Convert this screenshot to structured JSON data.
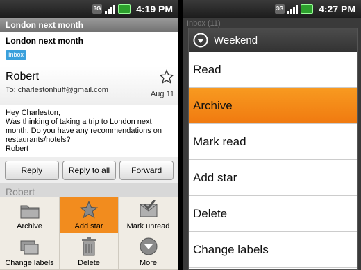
{
  "left": {
    "status_time": "4:19 PM",
    "title": "London next month",
    "subject": "London next month",
    "label": "Inbox",
    "message": {
      "sender": "Robert",
      "to": "To: charlestonhuff@gmail.com",
      "date": "Aug 11",
      "body_lines": [
        "Hey Charleston,",
        "Was thinking of taking a trip to London next",
        "month. Do you have any recommendations on",
        "restaurants/hotels?",
        "Robert"
      ]
    },
    "buttons": {
      "reply": "Reply",
      "reply_all": "Reply to all",
      "forward": "Forward"
    },
    "ghost_sender": "Robert",
    "actions": [
      {
        "label": "Archive",
        "icon": "folder-icon"
      },
      {
        "label": "Add star",
        "icon": "star-icon",
        "selected": true
      },
      {
        "label": "Mark unread",
        "icon": "envelope-check-icon"
      },
      {
        "label": "Change labels",
        "icon": "folders-icon"
      },
      {
        "label": "Delete",
        "icon": "trash-icon"
      },
      {
        "label": "More",
        "icon": "more-icon"
      }
    ]
  },
  "right": {
    "status_time": "4:27 PM",
    "bg_title": "Inbox (11)",
    "dialog_title": "Weekend",
    "menu": [
      "Read",
      "Archive",
      "Mark read",
      "Add star",
      "Delete",
      "Change labels"
    ],
    "selected": "Archive"
  },
  "colors": {
    "accent": "#f28c1e",
    "chip": "#3aa0dc",
    "battery": "#2da02d"
  }
}
